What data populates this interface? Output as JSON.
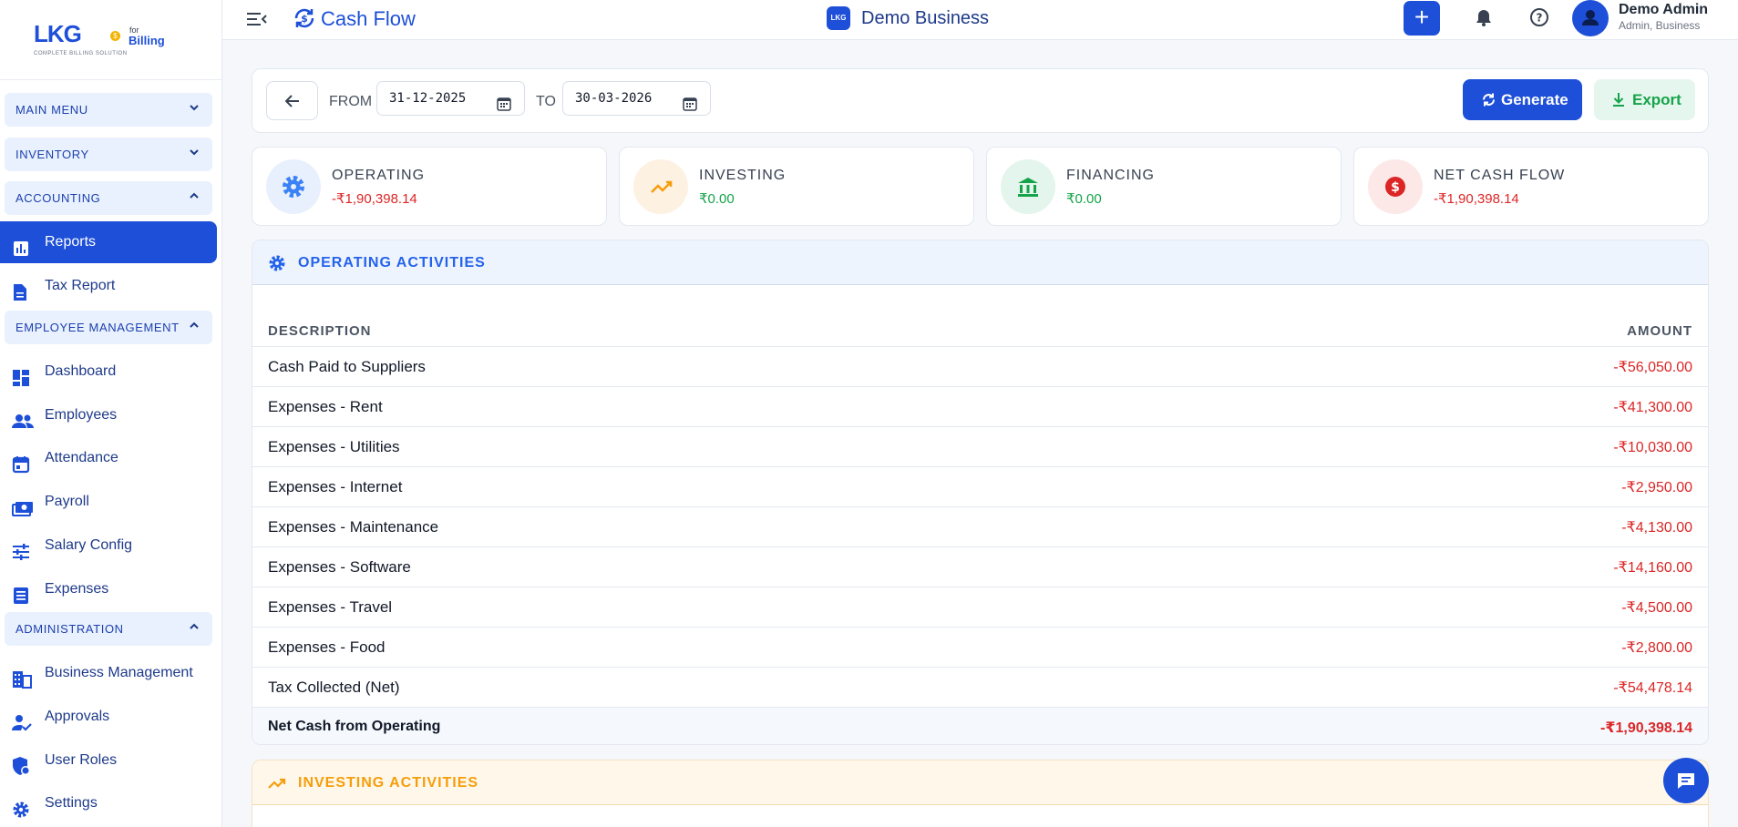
{
  "brand": {
    "name": "LKG",
    "for": "for",
    "billing": "Billing",
    "tagline": "COMPLETE BILLING SOLUTION"
  },
  "sidebar": {
    "sections": [
      {
        "label": "MAIN MENU",
        "chevron": "⌄"
      },
      {
        "label": "INVENTORY",
        "chevron": "⌄"
      },
      {
        "label": "ACCOUNTING",
        "chevron": "⌃"
      },
      {
        "label": "EMPLOYEE MANAGEMENT",
        "chevron": "⌃"
      },
      {
        "label": "ADMINISTRATION",
        "chevron": "⌃"
      }
    ],
    "items": [
      {
        "label": "Reports",
        "icon": "bar-chart-icon",
        "active": true
      },
      {
        "label": "Tax Report",
        "icon": "document-icon"
      },
      {
        "label": "Dashboard",
        "icon": "dashboard-icon"
      },
      {
        "label": "Employees",
        "icon": "people-icon"
      },
      {
        "label": "Attendance",
        "icon": "calendar-icon"
      },
      {
        "label": "Payroll",
        "icon": "money-icon"
      },
      {
        "label": "Salary Config",
        "icon": "sliders-icon"
      },
      {
        "label": "Expenses",
        "icon": "list-icon"
      },
      {
        "label": "Business Management",
        "icon": "building-icon"
      },
      {
        "label": "Approvals",
        "icon": "user-check-icon"
      },
      {
        "label": "User Roles",
        "icon": "shield-user-icon"
      },
      {
        "label": "Settings",
        "icon": "gear-icon"
      }
    ]
  },
  "topbar": {
    "page_title": "Cash Flow",
    "business_badge": "LKG",
    "business_name": "Demo Business",
    "user_name": "Demo Admin",
    "user_role": "Admin, Business"
  },
  "filter": {
    "from_label": "FROM",
    "from_value": "31-12-2025",
    "to_label": "TO",
    "to_value": "30-03-2026",
    "generate_label": "Generate",
    "export_label": "Export"
  },
  "summary": [
    {
      "label": "OPERATING",
      "value": "-₹1,90,398.14",
      "color": "#dc2626",
      "bg": "#e8f0fd",
      "icon": "gear-icon"
    },
    {
      "label": "INVESTING",
      "value": "₹0.00",
      "color": "#16a34a",
      "bg": "#fdf1e2",
      "icon": "trending-up-icon"
    },
    {
      "label": "FINANCING",
      "value": "₹0.00",
      "color": "#16a34a",
      "bg": "#e3f5ec",
      "icon": "bank-icon"
    },
    {
      "label": "NET CASH FLOW",
      "value": "-₹1,90,398.14",
      "color": "#dc2626",
      "bg": "#fde8e8",
      "icon": "dollar-icon"
    }
  ],
  "operating": {
    "title": "OPERATING ACTIVITIES",
    "col_description": "DESCRIPTION",
    "col_amount": "AMOUNT",
    "rows": [
      {
        "description": "Cash Paid to Suppliers",
        "amount": "-₹56,050.00"
      },
      {
        "description": "Expenses - Rent",
        "amount": "-₹41,300.00"
      },
      {
        "description": "Expenses - Utilities",
        "amount": "-₹10,030.00"
      },
      {
        "description": "Expenses - Internet",
        "amount": "-₹2,950.00"
      },
      {
        "description": "Expenses - Maintenance",
        "amount": "-₹4,130.00"
      },
      {
        "description": "Expenses - Software",
        "amount": "-₹14,160.00"
      },
      {
        "description": "Expenses - Travel",
        "amount": "-₹4,500.00"
      },
      {
        "description": "Expenses - Food",
        "amount": "-₹2,800.00"
      },
      {
        "description": "Tax Collected (Net)",
        "amount": "-₹54,478.14"
      }
    ],
    "total": {
      "description": "Net Cash from Operating",
      "amount": "-₹1,90,398.14"
    }
  },
  "investing": {
    "title": "INVESTING ACTIVITIES"
  },
  "colors": {
    "primary": "#1d4fd8",
    "negative": "#dc2626",
    "positive": "#16a34a",
    "investing": "#f59e0b"
  }
}
